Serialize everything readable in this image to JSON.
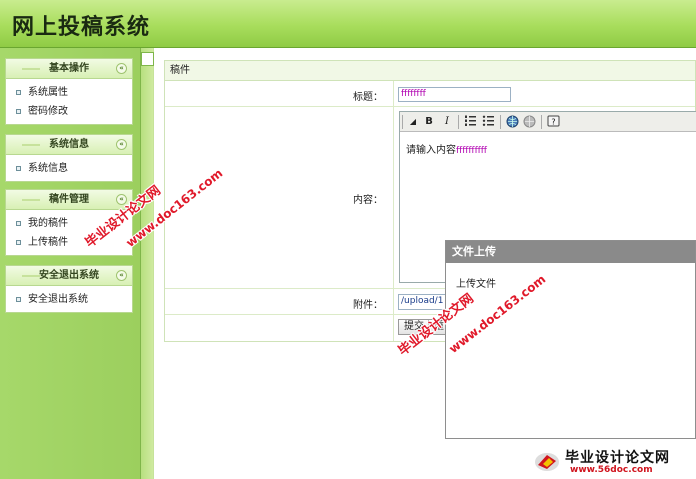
{
  "app": {
    "title": "网上投稿系统"
  },
  "sidebar": {
    "sections": [
      {
        "title": "基本操作",
        "items": [
          "系统属性",
          "密码修改"
        ]
      },
      {
        "title": "系统信息",
        "items": [
          "系统信息"
        ]
      },
      {
        "title": "稿件管理",
        "items": [
          "我的稿件",
          "上传稿件"
        ]
      },
      {
        "title": "安全退出系统",
        "items": [
          "安全退出系统"
        ]
      }
    ],
    "toggle_glyph": "«"
  },
  "form": {
    "header": "稿件",
    "title_label": "标题：",
    "title_value": "ffffffff",
    "content_label": "内容：",
    "content_placeholder": "请输入内容",
    "content_value": "ffffffffff",
    "attachment_label": "附件：",
    "attachment_value": "/upload/1",
    "submit_label": "提交",
    "reset_label": "重"
  },
  "editor_toolbar": {
    "bold": "B",
    "italic": "I",
    "icons": [
      "ordered-list-icon",
      "unordered-list-icon",
      "link-icon",
      "unlink-icon",
      "help-icon"
    ]
  },
  "dialog": {
    "title": "文件上传",
    "body_text": "上传文件"
  },
  "watermarks": [
    {
      "text": "毕业设计论文网"
    },
    {
      "text": "www.doc163.com"
    }
  ],
  "brand": {
    "name": "毕业设计论文网",
    "url": "www.56doc.com"
  },
  "colors": {
    "header_green": "#a8dd5c",
    "sidebar_green": "#a6d86a",
    "dialog_header": "#8a8a8a",
    "watermark_red": "#e0192a"
  }
}
